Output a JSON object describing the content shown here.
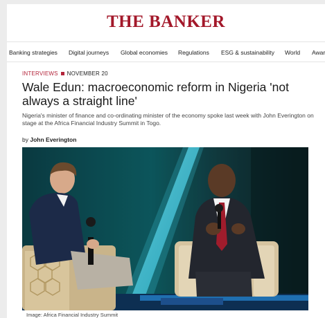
{
  "site": {
    "name": "THE BANKER"
  },
  "nav": {
    "items": [
      "Banking strategies",
      "Digital journeys",
      "Global economies",
      "Regulations",
      "ESG & sustainability",
      "World",
      "Awar"
    ]
  },
  "article": {
    "section": "INTERVIEWS",
    "date": "NOVEMBER 20",
    "headline": "Wale Edun: macroeconomic reform in Nigeria 'not always a straight line'",
    "standfirst": "Nigeria's minister of finance and co-ordinating minister of the economy spoke last week with John Everington on stage at the Africa Financial Industry Summit in Togo.",
    "byline_prefix": "by",
    "author": "John Everington",
    "image_caption": "Image: Africa Financial Industry Summit"
  },
  "colors": {
    "brand": "#a3182a",
    "kicker": "#b3243a",
    "stage_teal": "#0d5a60",
    "stage_light": "#2fb8d0"
  }
}
